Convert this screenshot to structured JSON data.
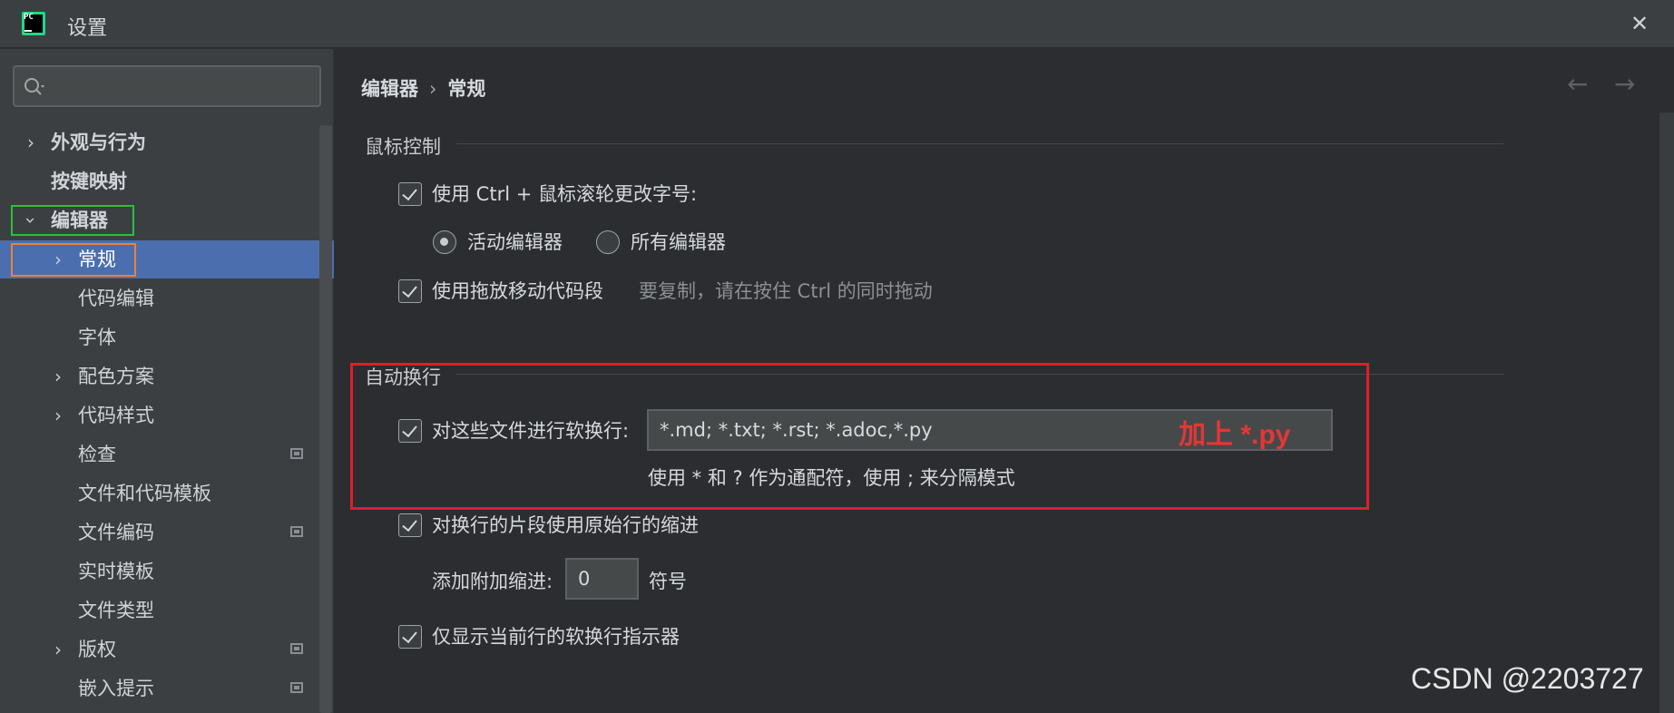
{
  "window": {
    "title": "设置",
    "logo_text": "PC",
    "close_glyph": "✕"
  },
  "sidebar": {
    "search": {
      "placeholder": "",
      "value": ""
    },
    "items": [
      {
        "label": "外观与行为",
        "expandable": true,
        "expanded": false,
        "bold": true
      },
      {
        "label": "按键映射",
        "expandable": false,
        "bold": true
      },
      {
        "label": "编辑器",
        "expandable": true,
        "expanded": true,
        "bold": true
      },
      {
        "label": "常规",
        "expandable": true,
        "expanded": false,
        "selected": true
      },
      {
        "label": "代码编辑"
      },
      {
        "label": "字体"
      },
      {
        "label": "配色方案",
        "expandable": true
      },
      {
        "label": "代码样式",
        "expandable": true
      },
      {
        "label": "检查",
        "has_project_icon": true
      },
      {
        "label": "文件和代码模板"
      },
      {
        "label": "文件编码",
        "has_project_icon": true
      },
      {
        "label": "实时模板"
      },
      {
        "label": "文件类型"
      },
      {
        "label": "版权",
        "expandable": true,
        "has_project_icon": true
      },
      {
        "label": "嵌入提示",
        "has_project_icon": true
      }
    ]
  },
  "main": {
    "breadcrumb": {
      "parent": "编辑器",
      "separator": "›",
      "current": "常规"
    },
    "nav": {
      "back": "←",
      "forward": "→"
    },
    "mouse_section": {
      "title": "鼠标控制",
      "ctrl_wheel": {
        "label": "使用 Ctrl + 鼠标滚轮更改字号:",
        "checked": true
      },
      "radio_active": {
        "label": "活动编辑器",
        "selected": true
      },
      "radio_all": {
        "label": "所有编辑器",
        "selected": false
      },
      "drag_drop": {
        "label": "使用拖放移动代码段",
        "hint": "要复制，请在按住 Ctrl 的同时拖动",
        "checked": true
      }
    },
    "softwrap_section": {
      "title": "自动换行",
      "soft_wrap_files": {
        "label": "对这些文件进行软换行:",
        "checked": true,
        "value": "*.md; *.txt; *.rst; *.adoc,*.py"
      },
      "annotation": "加上 *.py",
      "pattern_hint": "使用 * 和 ? 作为通配符，使用 ; 来分隔模式",
      "use_original_indent": {
        "label": "对换行的片段使用原始行的缩进",
        "checked": true
      },
      "extra_indent": {
        "label": "添加附加缩进:",
        "value": "0",
        "unit": "符号"
      },
      "show_indicator_current": {
        "label": "仅显示当前行的软换行指示器",
        "checked": true
      }
    }
  },
  "watermark": "CSDN @2203727",
  "colors": {
    "accent_selection": "#4b6eaf",
    "highlight_green": "#2bbf40",
    "highlight_orange": "#e8833a",
    "highlight_red": "#e11d2a"
  }
}
